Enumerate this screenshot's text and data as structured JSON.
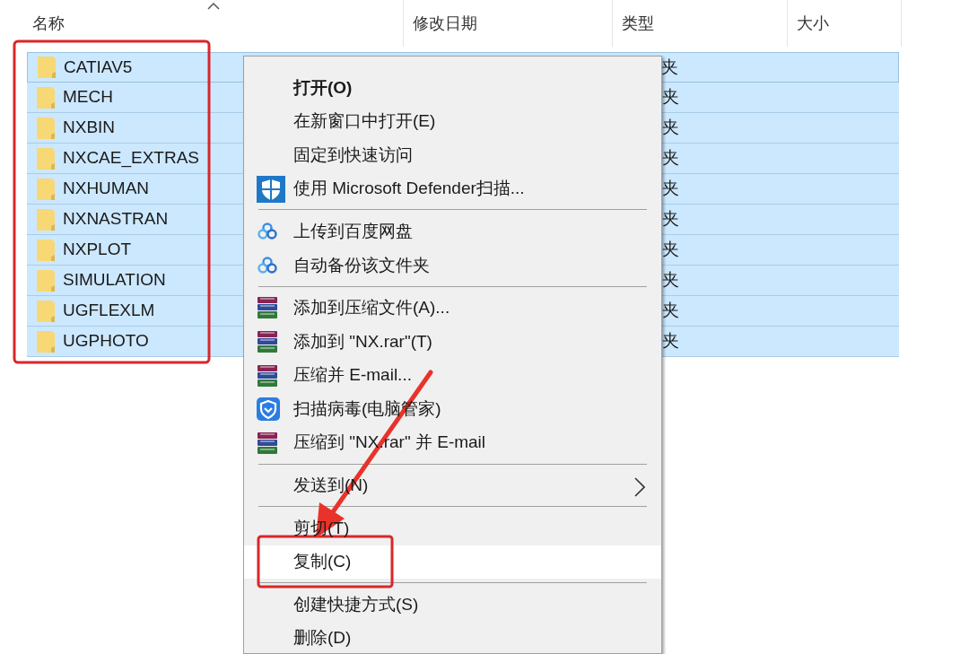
{
  "columns": [
    {
      "label": "名称",
      "sorted": true
    },
    {
      "label": "修改日期",
      "sorted": false
    },
    {
      "label": "类型",
      "sorted": false
    },
    {
      "label": "大小",
      "sorted": false
    }
  ],
  "rows": [
    {
      "name": "CATIAV5",
      "type": "夹",
      "selected": true,
      "focused": true
    },
    {
      "name": "MECH",
      "type": "夹",
      "selected": true,
      "focused": false
    },
    {
      "name": "NXBIN",
      "type": "夹",
      "selected": true,
      "focused": false
    },
    {
      "name": "NXCAE_EXTRAS",
      "type": "夹",
      "selected": true,
      "focused": false
    },
    {
      "name": "NXHUMAN",
      "type": "夹",
      "selected": true,
      "focused": false
    },
    {
      "name": "NXNASTRAN",
      "type": "夹",
      "selected": true,
      "focused": false
    },
    {
      "name": "NXPLOT",
      "type": "夹",
      "selected": true,
      "focused": false
    },
    {
      "name": "SIMULATION",
      "type": "夹",
      "selected": true,
      "focused": false
    },
    {
      "name": "UGFLEXLM",
      "type": "夹",
      "selected": true,
      "focused": false
    },
    {
      "name": "UGPHOTO",
      "type": "夹",
      "selected": true,
      "focused": false
    }
  ],
  "context_menu": {
    "groups": [
      [
        {
          "label": "打开(O)",
          "kind": "plain",
          "bold": true,
          "submenu": false,
          "highlighted": false
        },
        {
          "label": "在新窗口中打开(E)",
          "kind": "plain",
          "bold": false,
          "submenu": false,
          "highlighted": false
        },
        {
          "label": "固定到快速访问",
          "kind": "plain",
          "bold": false,
          "submenu": false,
          "highlighted": false
        },
        {
          "label": "使用 Microsoft Defender扫描...",
          "kind": "shield",
          "bold": false,
          "submenu": false,
          "highlighted": false
        }
      ],
      [
        {
          "label": "上传到百度网盘",
          "kind": "cloud",
          "bold": false,
          "submenu": false,
          "highlighted": false
        },
        {
          "label": "自动备份该文件夹",
          "kind": "cloud",
          "bold": false,
          "submenu": false,
          "highlighted": false
        }
      ],
      [
        {
          "label": "添加到压缩文件(A)...",
          "kind": "archive",
          "bold": false,
          "submenu": false,
          "highlighted": false
        },
        {
          "label": "添加到 \"NX.rar\"(T)",
          "kind": "archive",
          "bold": false,
          "submenu": false,
          "highlighted": false
        },
        {
          "label": "压缩并 E-mail...",
          "kind": "archive",
          "bold": false,
          "submenu": false,
          "highlighted": false
        },
        {
          "label": "扫描病毒(电脑管家)",
          "kind": "antivirus",
          "bold": false,
          "submenu": false,
          "highlighted": false
        },
        {
          "label": "压缩到 \"NX.rar\" 并 E-mail",
          "kind": "archive",
          "bold": false,
          "submenu": false,
          "highlighted": false
        }
      ],
      [
        {
          "label": "发送到(N)",
          "kind": "plain",
          "bold": false,
          "submenu": true,
          "highlighted": false
        }
      ],
      [
        {
          "label": "剪切(T)",
          "kind": "plain",
          "bold": false,
          "submenu": false,
          "highlighted": false
        },
        {
          "label": "复制(C)",
          "kind": "plain",
          "bold": false,
          "submenu": false,
          "highlighted": true
        }
      ],
      [
        {
          "label": "创建快捷方式(S)",
          "kind": "plain",
          "bold": false,
          "submenu": false,
          "highlighted": false
        },
        {
          "label": "删除(D)",
          "kind": "plain",
          "bold": false,
          "submenu": false,
          "highlighted": false
        }
      ]
    ]
  }
}
